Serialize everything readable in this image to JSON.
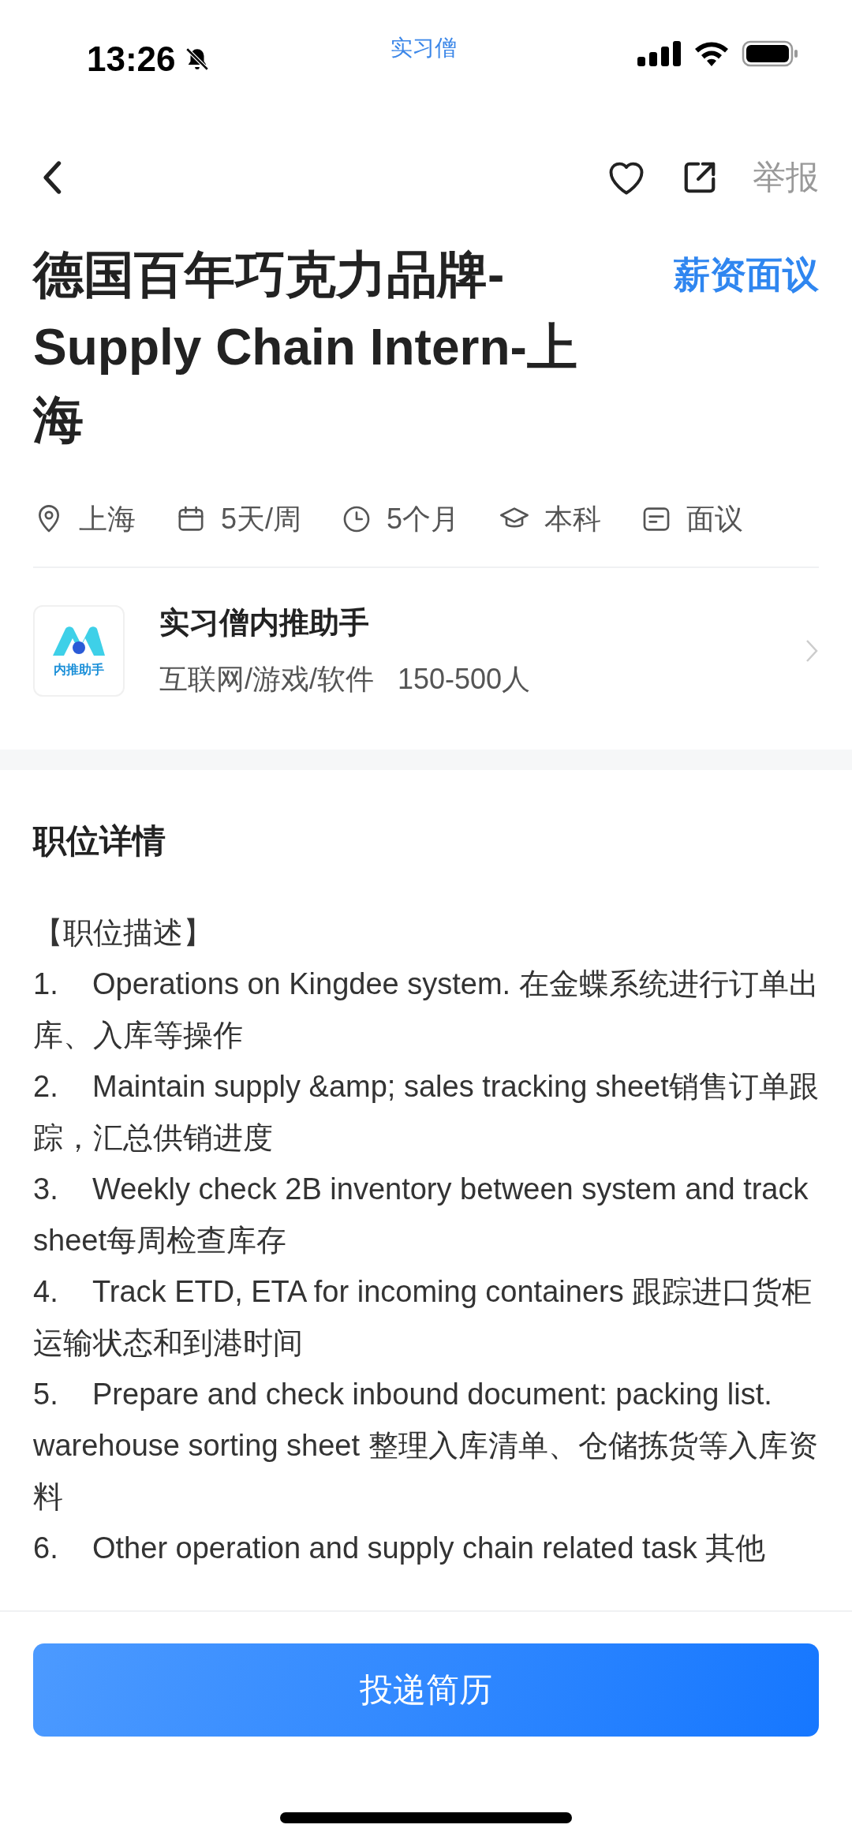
{
  "status_bar": {
    "time": "13:26",
    "back_app": "实习僧"
  },
  "nav": {
    "report": "举报"
  },
  "job": {
    "title": "德国百年巧克力品牌-Supply Chain Intern-上海",
    "salary": "薪资面议"
  },
  "tags": [
    {
      "kind": "location",
      "text": "上海"
    },
    {
      "kind": "calendar",
      "text": "5天/周"
    },
    {
      "kind": "clock",
      "text": "5个月"
    },
    {
      "kind": "degree",
      "text": "本科"
    },
    {
      "kind": "salary",
      "text": "面议"
    }
  ],
  "company": {
    "logo_text": "内推助手",
    "name": "实习僧内推助手",
    "industry": "互联网/游戏/软件",
    "size": "150-500人"
  },
  "details": {
    "heading": "职位详情",
    "section_label": "【职位描述】",
    "items": [
      {
        "number": "1.",
        "text": "Operations on Kingdee system. 在金蝶系统进行订单出库、入库等操作"
      },
      {
        "number": "2.",
        "text": "Maintain supply &amp; sales tracking sheet销售订单跟踪，汇总供销进度"
      },
      {
        "number": "3.",
        "text": "Weekly check 2B inventory between system and track sheet每周检查库存"
      },
      {
        "number": "4.",
        "text": "Track ETD, ETA for incoming containers 跟踪进口货柜运输状态和到港时间"
      },
      {
        "number": "5.",
        "text": "Prepare and check inbound document: packing list. warehouse sorting sheet 整理入库清单、仓储拣货等入库资料"
      },
      {
        "number": "6.",
        "text": "Other operation and supply chain related task 其他"
      }
    ]
  },
  "apply_button": "投递简历"
}
